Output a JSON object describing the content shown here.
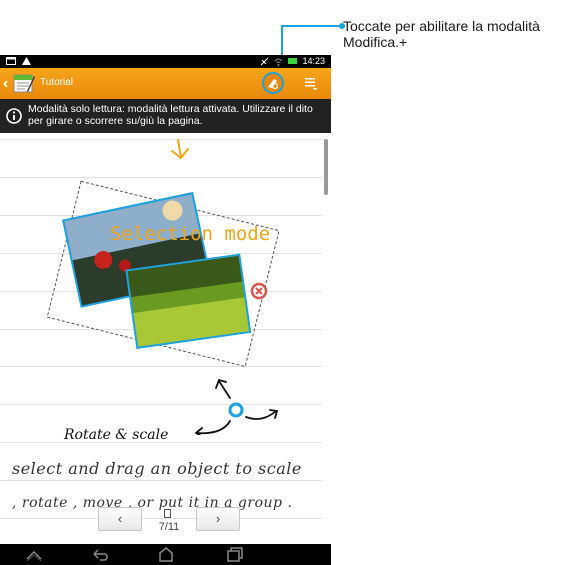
{
  "callout": {
    "text": "Toccate per abilitare la modalità Modifica.+"
  },
  "status_bar": {
    "time": "14:23"
  },
  "action_bar": {
    "back_symbol": "‹",
    "title": "Tutorial",
    "accent": "#1ba3e0",
    "bar_color": "#f09a18"
  },
  "banner": {
    "message": "Modalità solo lettura: modalità lettura attivata. Utilizzare il dito per girare o scorrere su/giù la pagina."
  },
  "note": {
    "heading": "Selection mode",
    "rotate_label": "Rotate & scale",
    "handwriting_line1": "select and drag an object to scale",
    "handwriting_line2": ", rotate , move , or put it in a group ."
  },
  "pager": {
    "page": "7/11",
    "prev_symbol": "‹",
    "next_symbol": "›"
  },
  "icons": [
    "back-chevron-icon",
    "app-icon",
    "edit-mode-icon",
    "menu-icon",
    "info-icon",
    "remove-icon",
    "rotate-handle-icon",
    "page-icon",
    "nav-home-icon",
    "nav-back-icon",
    "nav-overview-icon",
    "nav-recent-icon",
    "signal-icon",
    "wifi-icon",
    "battery-icon"
  ]
}
